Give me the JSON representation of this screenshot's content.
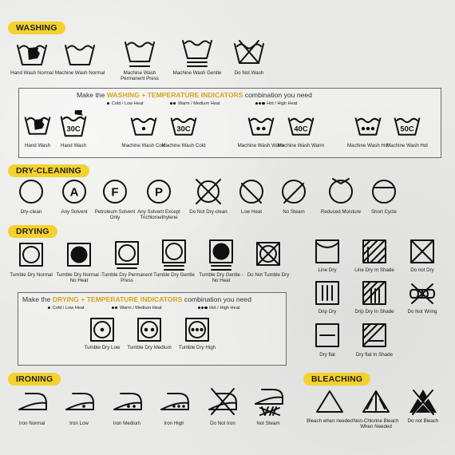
{
  "sections": {
    "washing": "WASHING",
    "dry_cleaning": "DRY-CLEANING",
    "drying": "DRYING",
    "ironing": "IRONING",
    "bleaching": "BLEACHING"
  },
  "washing": {
    "symbols": [
      {
        "label": "Hand Wash Normal",
        "icon": "hand-wash-icon"
      },
      {
        "label": "Machine Wash Normal",
        "icon": "machine-wash-icon"
      },
      {
        "label": "Machine Wash Permanent Press",
        "icon": "machine-wash-permanent-press-icon"
      },
      {
        "label": "Machine Wash Gentle",
        "icon": "machine-wash-gentle-icon"
      },
      {
        "label": "Do Not Wash",
        "icon": "do-not-wash-icon"
      }
    ],
    "combo": {
      "prefix": "Make the",
      "highlight": "WASHING + TEMPERATURE INDICATORS",
      "suffix": "combination you need",
      "legend": [
        "Cold / Low Heat",
        "Warm / Medium Heat",
        "Hot / High Heat"
      ],
      "symbols": [
        {
          "label": "Hand Wash",
          "icon": "hand-wash-icon"
        },
        {
          "label": "Hand Wash",
          "icon": "hand-wash-30c-icon",
          "temp": "30C"
        },
        {
          "label": "Machine Wash Cold",
          "icon": "machine-wash-one-dot-icon"
        },
        {
          "label": "Machine Wash Cold",
          "icon": "machine-wash-30c-icon",
          "temp": "30C"
        },
        {
          "label": "Machine Wash Warm",
          "icon": "machine-wash-two-dots-icon"
        },
        {
          "label": "Machine Wash Warm",
          "icon": "machine-wash-40c-icon",
          "temp": "40C"
        },
        {
          "label": "Machine Wash Hot",
          "icon": "machine-wash-three-dots-icon"
        },
        {
          "label": "Machine Wash Hot",
          "icon": "machine-wash-50c-icon",
          "temp": "50C"
        }
      ]
    }
  },
  "dry_cleaning": {
    "symbols": [
      {
        "label": "Dry-clean",
        "icon": "dry-clean-icon"
      },
      {
        "label": "Any Solvent",
        "icon": "any-solvent-icon",
        "letter": "A"
      },
      {
        "label": "Petroleum Solvent Only",
        "icon": "petroleum-solvent-icon",
        "letter": "F"
      },
      {
        "label": "Any Solvent Except Trichloroethylene",
        "icon": "solvent-except-trichloroethylene-icon",
        "letter": "P"
      },
      {
        "label": "Do Not Dry-clean",
        "icon": "do-not-dry-clean-icon"
      },
      {
        "label": "Low Heat",
        "icon": "dry-clean-low-heat-icon"
      },
      {
        "label": "No Steam",
        "icon": "dry-clean-no-steam-icon"
      },
      {
        "label": "Reduced Moisture",
        "icon": "dry-clean-reduced-moisture-icon"
      },
      {
        "label": "Short Cycle",
        "icon": "dry-clean-short-cycle-icon"
      }
    ]
  },
  "drying": {
    "symbols": [
      {
        "label": "Tumble Dry Normal",
        "icon": "tumble-dry-icon"
      },
      {
        "label": "Tumble Dry Normal - No Heat",
        "icon": "tumble-dry-no-heat-icon"
      },
      {
        "label": "Tumble Dry Permanent Press",
        "icon": "tumble-dry-permanent-press-icon"
      },
      {
        "label": "Tumble Dry Gentle",
        "icon": "tumble-dry-gentle-icon"
      },
      {
        "label": "Tumble Dry Gentle - No Heat",
        "icon": "tumble-dry-gentle-no-heat-icon"
      },
      {
        "label": "Do Not Tumble Dry",
        "icon": "do-not-tumble-dry-icon"
      }
    ],
    "combo": {
      "prefix": "Make the",
      "highlight": "DRYING + TEMPERATURE INDICATORS",
      "suffix": "combination you need",
      "legend": [
        "Cold / Low Heat",
        "Warm / Medium Heat",
        "Hot / High Heat"
      ],
      "symbols": [
        {
          "label": "Tumble Dry Low",
          "icon": "tumble-dry-low-icon"
        },
        {
          "label": "Tumble Dry Medium",
          "icon": "tumble-dry-medium-icon"
        },
        {
          "label": "Tumble Dry High",
          "icon": "tumble-dry-high-icon"
        }
      ]
    },
    "natural": [
      {
        "label": "Line Dry",
        "icon": "line-dry-icon"
      },
      {
        "label": "Line Dry In Shade",
        "icon": "line-dry-in-shade-icon"
      },
      {
        "label": "Do not Dry",
        "icon": "do-not-dry-icon"
      },
      {
        "label": "Drip Dry",
        "icon": "drip-dry-icon"
      },
      {
        "label": "Drip Dry In Shade",
        "icon": "drip-dry-in-shade-icon"
      },
      {
        "label": "Do Not Wring",
        "icon": "do-not-wring-icon"
      },
      {
        "label": "Dry flat",
        "icon": "dry-flat-icon"
      },
      {
        "label": "Dry flat In Shade",
        "icon": "dry-flat-in-shade-icon"
      }
    ]
  },
  "ironing": {
    "symbols": [
      {
        "label": "Iron Normal",
        "icon": "iron-normal-icon"
      },
      {
        "label": "Iron Low",
        "icon": "iron-low-icon"
      },
      {
        "label": "Iron Medium",
        "icon": "iron-medium-icon"
      },
      {
        "label": "Iron High",
        "icon": "iron-high-icon"
      },
      {
        "label": "Do Not Iron",
        "icon": "do-not-iron-icon"
      },
      {
        "label": "Not Steam",
        "icon": "no-steam-iron-icon"
      }
    ]
  },
  "bleaching": {
    "symbols": [
      {
        "label": "Bleach when needed",
        "icon": "bleach-icon"
      },
      {
        "label": "Non-Chlorine Bleach When Needed",
        "icon": "non-chlorine-bleach-icon"
      },
      {
        "label": "Do not Bleach",
        "icon": "do-not-bleach-icon"
      }
    ]
  },
  "colors": {
    "accent": "#f4d22e",
    "ink": "#111111",
    "highlight_text": "#d4a51c"
  }
}
